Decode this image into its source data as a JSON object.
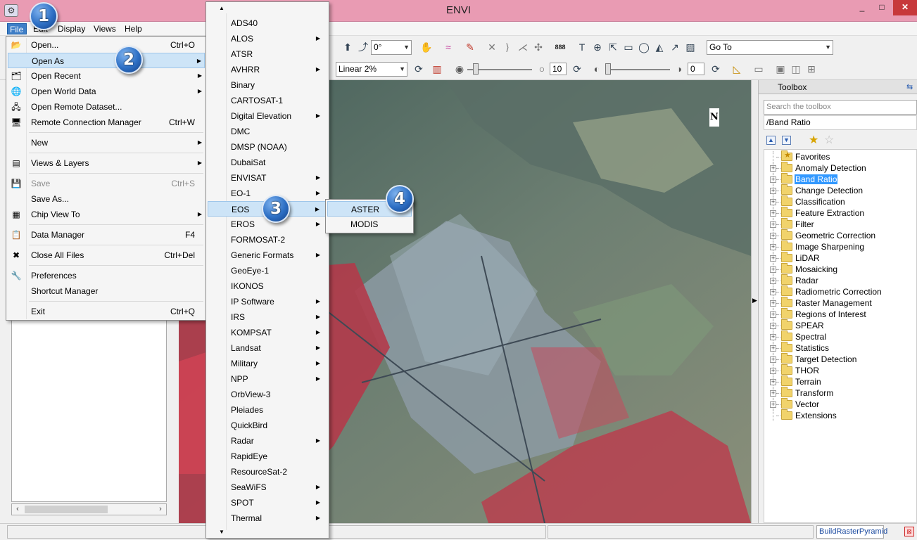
{
  "window": {
    "title": "ENVI",
    "min": "_",
    "max": "□",
    "close": "✕"
  },
  "menubar": [
    "File",
    "Edit",
    "Display",
    "Views",
    "Help"
  ],
  "toolbar": {
    "rotation": "0°",
    "stretch": "Linear 2%",
    "brightness": "10",
    "transparency": "0",
    "goto": "Go To"
  },
  "file_menu": {
    "items": [
      {
        "label": "Open...",
        "shortcut": "Ctrl+O",
        "submenu": false,
        "icon": "open-folder-icon",
        "glyph": "📂"
      },
      {
        "label": "Open As",
        "shortcut": "",
        "submenu": true,
        "icon": "",
        "glyph": "",
        "highlighted": true
      },
      {
        "label": "Open Recent",
        "shortcut": "",
        "submenu": true,
        "icon": "recent-files-icon",
        "glyph": "🗂"
      },
      {
        "label": "Open World Data",
        "shortcut": "",
        "submenu": true,
        "icon": "globe-icon",
        "glyph": "🌐"
      },
      {
        "label": "Open Remote Dataset...",
        "shortcut": "",
        "submenu": false,
        "icon": "remote-dataset-icon",
        "glyph": "🖧"
      },
      {
        "label": "Remote Connection Manager",
        "shortcut": "Ctrl+W",
        "submenu": false,
        "icon": "monitor-icon",
        "glyph": "🖥"
      },
      {
        "label": "New",
        "shortcut": "",
        "submenu": true,
        "icon": "",
        "glyph": ""
      },
      {
        "label": "Views & Layers",
        "shortcut": "",
        "submenu": true,
        "icon": "layers-icon",
        "glyph": "▤"
      },
      {
        "label": "Save",
        "shortcut": "Ctrl+S",
        "submenu": false,
        "icon": "save-icon",
        "glyph": "💾",
        "disabled": true
      },
      {
        "label": "Save As...",
        "shortcut": "",
        "submenu": false,
        "icon": "",
        "glyph": ""
      },
      {
        "label": "Chip View To",
        "shortcut": "",
        "submenu": true,
        "icon": "chip-view-icon",
        "glyph": "▦"
      },
      {
        "label": "Data Manager",
        "shortcut": "F4",
        "submenu": false,
        "icon": "data-manager-icon",
        "glyph": "📋"
      },
      {
        "label": "Close All Files",
        "shortcut": "Ctrl+Del",
        "submenu": false,
        "icon": "close-files-icon",
        "glyph": "✖"
      },
      {
        "label": "Preferences",
        "shortcut": "",
        "submenu": false,
        "icon": "wrench-icon",
        "glyph": "🔧"
      },
      {
        "label": "Shortcut Manager",
        "shortcut": "",
        "submenu": false,
        "icon": "",
        "glyph": ""
      },
      {
        "label": "Exit",
        "shortcut": "Ctrl+Q",
        "submenu": false,
        "icon": "",
        "glyph": ""
      }
    ]
  },
  "open_as_menu": {
    "items": [
      {
        "label": "ADS40",
        "submenu": false
      },
      {
        "label": "ALOS",
        "submenu": true
      },
      {
        "label": "ATSR",
        "submenu": false
      },
      {
        "label": "AVHRR",
        "submenu": true
      },
      {
        "label": "Binary",
        "submenu": false
      },
      {
        "label": "CARTOSAT-1",
        "submenu": false
      },
      {
        "label": "Digital Elevation",
        "submenu": true
      },
      {
        "label": "DMC",
        "submenu": false
      },
      {
        "label": "DMSP (NOAA)",
        "submenu": false
      },
      {
        "label": "DubaiSat",
        "submenu": false
      },
      {
        "label": "ENVISAT",
        "submenu": true
      },
      {
        "label": "EO-1",
        "submenu": true
      },
      {
        "label": "EOS",
        "submenu": true,
        "highlighted": true
      },
      {
        "label": "EROS",
        "submenu": true
      },
      {
        "label": "FORMOSAT-2",
        "submenu": false
      },
      {
        "label": "Generic Formats",
        "submenu": true
      },
      {
        "label": "GeoEye-1",
        "submenu": false
      },
      {
        "label": "IKONOS",
        "submenu": false
      },
      {
        "label": "IP Software",
        "submenu": true
      },
      {
        "label": "IRS",
        "submenu": true
      },
      {
        "label": "KOMPSAT",
        "submenu": true
      },
      {
        "label": "Landsat",
        "submenu": true
      },
      {
        "label": "Military",
        "submenu": true
      },
      {
        "label": "NPP",
        "submenu": true
      },
      {
        "label": "OrbView-3",
        "submenu": false
      },
      {
        "label": "Pleiades",
        "submenu": false
      },
      {
        "label": "QuickBird",
        "submenu": false
      },
      {
        "label": "Radar",
        "submenu": true
      },
      {
        "label": "RapidEye",
        "submenu": false
      },
      {
        "label": "ResourceSat-2",
        "submenu": false
      },
      {
        "label": "SeaWiFS",
        "submenu": true
      },
      {
        "label": "SPOT",
        "submenu": true
      },
      {
        "label": "Thermal",
        "submenu": true
      }
    ],
    "scroll_up": "▲",
    "scroll_down": "▼"
  },
  "eos_menu": {
    "items": [
      {
        "label": "ASTER",
        "highlighted": true
      },
      {
        "label": "MODIS"
      }
    ]
  },
  "callouts": [
    "1",
    "2",
    "3",
    "4"
  ],
  "toolbox": {
    "title": "Toolbox",
    "search_placeholder": "Search the toolbox",
    "path": "/Band Ratio",
    "tree": [
      {
        "label": "Favorites",
        "expandable": false,
        "favorite": true
      },
      {
        "label": "Anomaly Detection",
        "expandable": true
      },
      {
        "label": "Band Ratio",
        "expandable": true,
        "selected": true
      },
      {
        "label": "Change Detection",
        "expandable": true
      },
      {
        "label": "Classification",
        "expandable": true
      },
      {
        "label": "Feature Extraction",
        "expandable": true
      },
      {
        "label": "Filter",
        "expandable": true
      },
      {
        "label": "Geometric Correction",
        "expandable": true
      },
      {
        "label": "Image Sharpening",
        "expandable": true
      },
      {
        "label": "LiDAR",
        "expandable": true
      },
      {
        "label": "Mosaicking",
        "expandable": true
      },
      {
        "label": "Radar",
        "expandable": true
      },
      {
        "label": "Radiometric Correction",
        "expandable": true
      },
      {
        "label": "Raster Management",
        "expandable": true
      },
      {
        "label": "Regions of Interest",
        "expandable": true
      },
      {
        "label": "SPEAR",
        "expandable": true
      },
      {
        "label": "Spectral",
        "expandable": true
      },
      {
        "label": "Statistics",
        "expandable": true
      },
      {
        "label": "Target Detection",
        "expandable": true
      },
      {
        "label": "THOR",
        "expandable": true
      },
      {
        "label": "Terrain",
        "expandable": true
      },
      {
        "label": "Transform",
        "expandable": true
      },
      {
        "label": "Vector",
        "expandable": true
      },
      {
        "label": "Extensions",
        "expandable": false
      }
    ]
  },
  "image_view": {
    "north_arrow": "N"
  },
  "status": {
    "process": "BuildRasterPyramid"
  }
}
